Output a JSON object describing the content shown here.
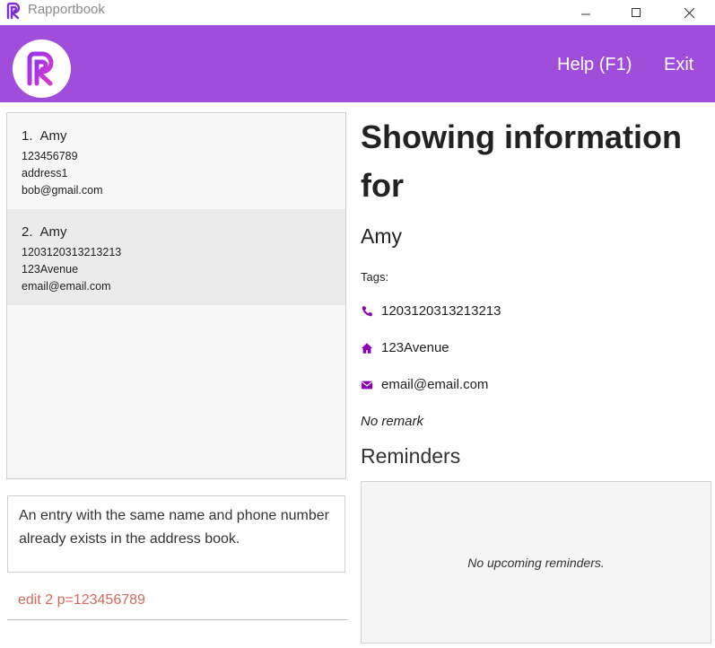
{
  "window": {
    "title": "Rapportbook",
    "controls": {
      "minimize": "minimize-icon",
      "maximize": "maximize-icon",
      "close": "close-icon"
    }
  },
  "header": {
    "logo": "rapportbook-logo",
    "menu": {
      "help": "Help (F1)",
      "exit": "Exit"
    },
    "background_color": "#a14ddc"
  },
  "persons": [
    {
      "index": "1.",
      "name": "Amy",
      "phone": "123456789",
      "address": "address1",
      "email": "bob@gmail.com"
    },
    {
      "index": "2.",
      "name": "Amy",
      "phone": "1203120313213213",
      "address": "123Avenue",
      "email": "email@email.com"
    }
  ],
  "result_message": "An entry with the same name and phone number already exists in the address book.",
  "command_input": "edit 2 p=123456789",
  "detail": {
    "heading": "Showing information for",
    "name": "Amy",
    "tags_label": "Tags:",
    "phone": "1203120313213213",
    "address": "123Avenue",
    "email": "email@email.com",
    "remark": "No remark",
    "reminders_heading": "Reminders",
    "reminders_empty": "No upcoming reminders.",
    "icon_color": "#8b00b5"
  }
}
